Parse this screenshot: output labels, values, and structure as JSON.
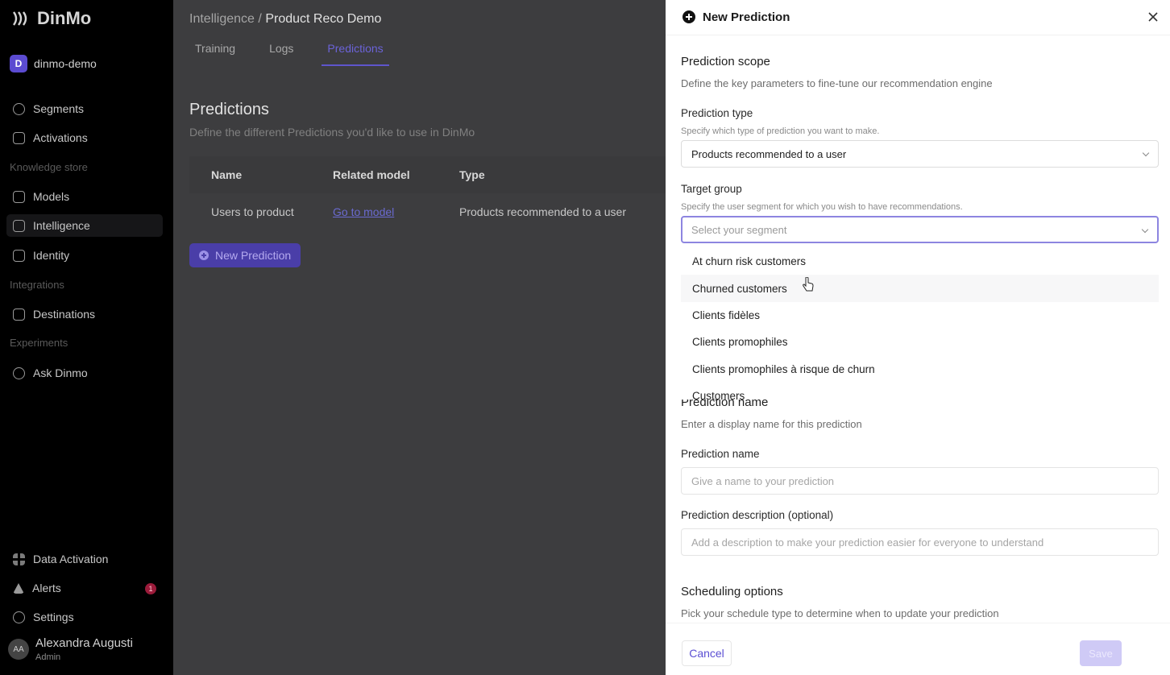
{
  "sidebar": {
    "brand": "DinMo",
    "workspace": {
      "initial": "D",
      "name": "dinmo-demo"
    },
    "items": {
      "segments": "Segments",
      "activations": "Activations",
      "section_knowledge": "Knowledge store",
      "models": "Models",
      "intelligence": "Intelligence",
      "identity": "Identity",
      "section_integrations": "Integrations",
      "destinations": "Destinations",
      "section_experiments": "Experiments",
      "ask_dinmo": "Ask Dinmo",
      "data_activation": "Data Activation",
      "alerts": "Alerts",
      "alerts_count": "1",
      "settings": "Settings"
    },
    "user": {
      "initials": "AA",
      "name": "Alexandra Augusti",
      "role": "Admin"
    }
  },
  "main": {
    "breadcrumb_root": "Intelligence",
    "breadcrumb_sep": "/",
    "breadcrumb_current": "Product Reco Demo",
    "tabs": {
      "training": "Training",
      "logs": "Logs",
      "predictions": "Predictions"
    },
    "title": "Predictions",
    "subtitle": "Define the different Predictions you'd like to use in DinMo",
    "table": {
      "headers": {
        "name": "Name",
        "model": "Related model",
        "type": "Type"
      },
      "rows": [
        {
          "name": "Users to product",
          "model": "Go to model",
          "type": "Products recommended to a user"
        }
      ]
    },
    "new_button": "New Prediction"
  },
  "panel": {
    "title": "New Prediction",
    "scope_title": "Prediction scope",
    "scope_desc": "Define the key parameters to fine-tune our recommendation engine",
    "type_label": "Prediction type",
    "type_help": "Specify which type of prediction you want to make.",
    "type_value": "Products recommended to a user",
    "target_label": "Target group",
    "target_help": "Specify the user segment for which you wish to have recommendations.",
    "target_placeholder": "Select your segment",
    "segments": [
      "At churn risk customers",
      "Churned customers",
      "Clients fidèles",
      "Clients promophiles",
      "Clients promophiles à risque de churn",
      "Customers"
    ],
    "name_section_title": "Prediction name",
    "name_section_desc": "Enter a display name for this prediction",
    "name_label": "Prediction name",
    "name_placeholder": "Give a name to your prediction",
    "desc_label": "Prediction description (optional)",
    "desc_placeholder": "Add a description to make your prediction easier for everyone to understand",
    "schedule_title": "Scheduling options",
    "schedule_desc": "Pick your schedule type to determine when to update your prediction",
    "cancel": "Cancel",
    "save": "Save"
  }
}
